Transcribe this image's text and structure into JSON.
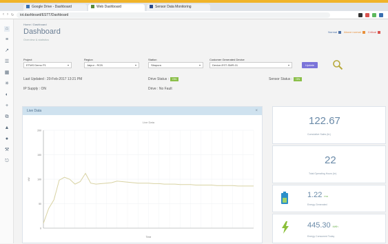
{
  "browser": {
    "tabs": [
      {
        "label": "Google Drive - Dashboard"
      },
      {
        "label": "Web Dashboard"
      },
      {
        "label": "Sensor Data Monitoring"
      }
    ],
    "address": "iot.dashboard/ESTT/Dashboard"
  },
  "nav": {
    "breadcrumb": "Home / Dashboard",
    "title": "Dashboard",
    "subtitle": "Overview & statistics"
  },
  "legend": [
    {
      "label": "Normal",
      "color": "#4a6fa5"
    },
    {
      "label": "Above normal",
      "color": "#e8903a"
    },
    {
      "label": "Critical",
      "color": "#d9534f"
    }
  ],
  "filters": {
    "project": {
      "label": "Project",
      "value": "ETMS Demo P1"
    },
    "region": {
      "label": "Region",
      "value": "Jaipur - RCB"
    },
    "station": {
      "label": "Station",
      "value": "Sitapura"
    },
    "device": {
      "label": "Customer Generated Device",
      "value": "Device-EST-SMR-01"
    },
    "update_label": "Update"
  },
  "info": {
    "last_updated": "Last Updated : 20-Feb-2017 13:21 PM",
    "ip_supply": "IP Supply : ON",
    "drive_status_label": "Drive Status :",
    "drive_status_value": "ON",
    "drive_error": "Drive : No Fault",
    "sensor_status_label": "Sensor Status :",
    "sensor_status_value": "ON"
  },
  "panel": {
    "title": "Live Data",
    "close": "×"
  },
  "chart_data": {
    "type": "line",
    "title": "Live Data",
    "xlabel": "Time",
    "ylabel": "kW",
    "ylim": [
      0,
      200
    ],
    "x": [
      0,
      1,
      2,
      3,
      4,
      5,
      6,
      7,
      8,
      9,
      10,
      11,
      12,
      13,
      14,
      15,
      16,
      17,
      18,
      19,
      20,
      21,
      22,
      23,
      24,
      25,
      26,
      27,
      28,
      29,
      30,
      31,
      32,
      33,
      34,
      35,
      36,
      37,
      38,
      39,
      40
    ],
    "series": [
      {
        "values": [
          10,
          40,
          58,
          98,
          104,
          100,
          90,
          95,
          112,
          92,
          90,
          91,
          92,
          93,
          96,
          95,
          94,
          93,
          92,
          92,
          92,
          91,
          91,
          90,
          90,
          90,
          89,
          89,
          89,
          88,
          88,
          88,
          88,
          87,
          87,
          87,
          87,
          86,
          86,
          86,
          86
        ],
        "color": "#d8d2a2"
      }
    ],
    "grid": true
  },
  "cards": [
    {
      "value": "122.67",
      "unit": "",
      "label": "Cumulative Sales (kL)",
      "icon": "none"
    },
    {
      "value": "22",
      "unit": "",
      "label": "Total Operating Hours (hr)",
      "icon": "none"
    },
    {
      "value": "1.22",
      "unit": "mu",
      "label": "Energy Generated",
      "icon": "battery-icon"
    },
    {
      "value": "445.30",
      "unit": "kWh",
      "label": "Energy Consumed Today",
      "icon": "lightning-icon"
    }
  ]
}
